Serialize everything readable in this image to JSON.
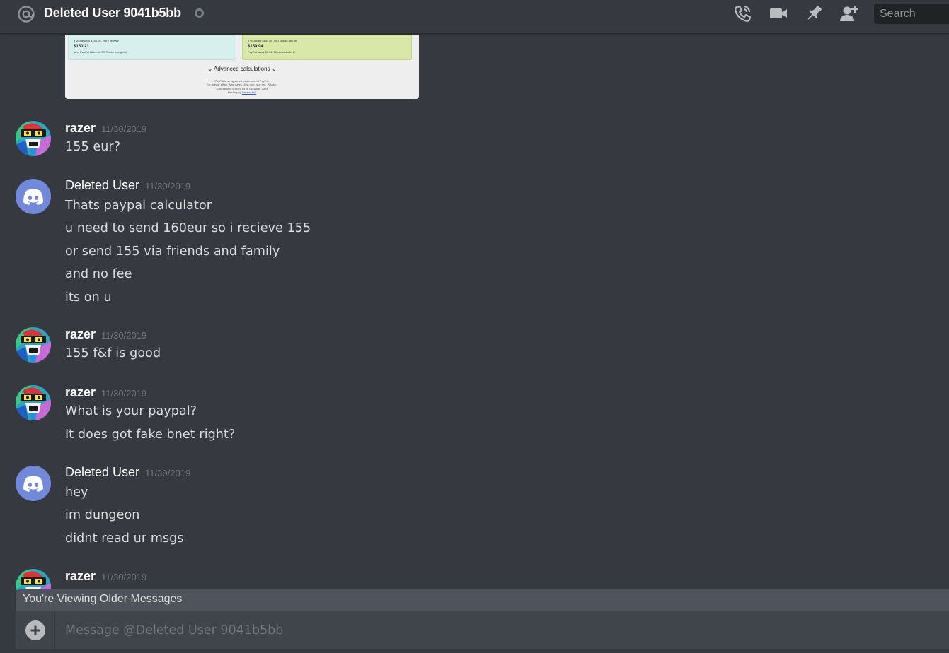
{
  "header": {
    "title": "Deleted User 9041b5bb",
    "status": "offline",
    "icons": [
      "at-icon",
      "call-icon",
      "video-icon",
      "pin-icon",
      "add-friend-icon"
    ],
    "search_placeholder": "Search"
  },
  "attachment": {
    "left_card": {
      "line1": "If you ask for $155.00, you'll receive",
      "amount": "$150.21",
      "line2": "after PayPal takes $4.79. Those mongrels!"
    },
    "right_card": {
      "line1": "If you want $155.00, you should ask for",
      "amount": "$159.94",
      "line2": "PayPal takes $4.94. Those swindlers!"
    },
    "advanced": "Advanced calculations",
    "footer": [
      "PayPal is a registered trademark of PayPal.",
      "Or maybe eBay. Who cares. Just don't sue me. Please.",
      "Calculations current as of 1 August, 2014"
    ],
    "hosting_prefix": "Hosting by",
    "hosting_link": "DreamHost"
  },
  "messages": [
    {
      "author": "razer",
      "timestamp": "11/30/2019",
      "avatar": "razer-avatar",
      "lines": [
        "155 eur?"
      ]
    },
    {
      "author": "Deleted User",
      "timestamp": "11/30/2019",
      "avatar": "discord-avatar",
      "lines": [
        "Thats paypal calculator",
        "u need to send 160eur so i recieve 155",
        "or send 155 via friends and family",
        "and no fee",
        "its on u"
      ]
    },
    {
      "author": "razer",
      "timestamp": "11/30/2019",
      "avatar": "razer-avatar",
      "lines": [
        "155 f&f is good"
      ]
    },
    {
      "author": "razer",
      "timestamp": "11/30/2019",
      "avatar": "razer-avatar",
      "lines": [
        "What is your paypal?",
        "It does got fake bnet right?"
      ]
    },
    {
      "author": "Deleted User",
      "timestamp": "11/30/2019",
      "avatar": "discord-avatar",
      "lines": [
        "hey",
        "im dungeon",
        "didnt read ur msgs"
      ]
    },
    {
      "author": "razer",
      "timestamp": "11/30/2019",
      "avatar": "razer-avatar",
      "lines": []
    }
  ],
  "older_messages_text": "You're Viewing Older Messages",
  "composer": {
    "placeholder": "Message @Deleted User 9041b5bb"
  },
  "colors": {
    "background": "#36393f",
    "blurple": "#7289da",
    "composer": "#40444b",
    "older_bar": "#4f545c",
    "timestamp": "#72767d"
  }
}
